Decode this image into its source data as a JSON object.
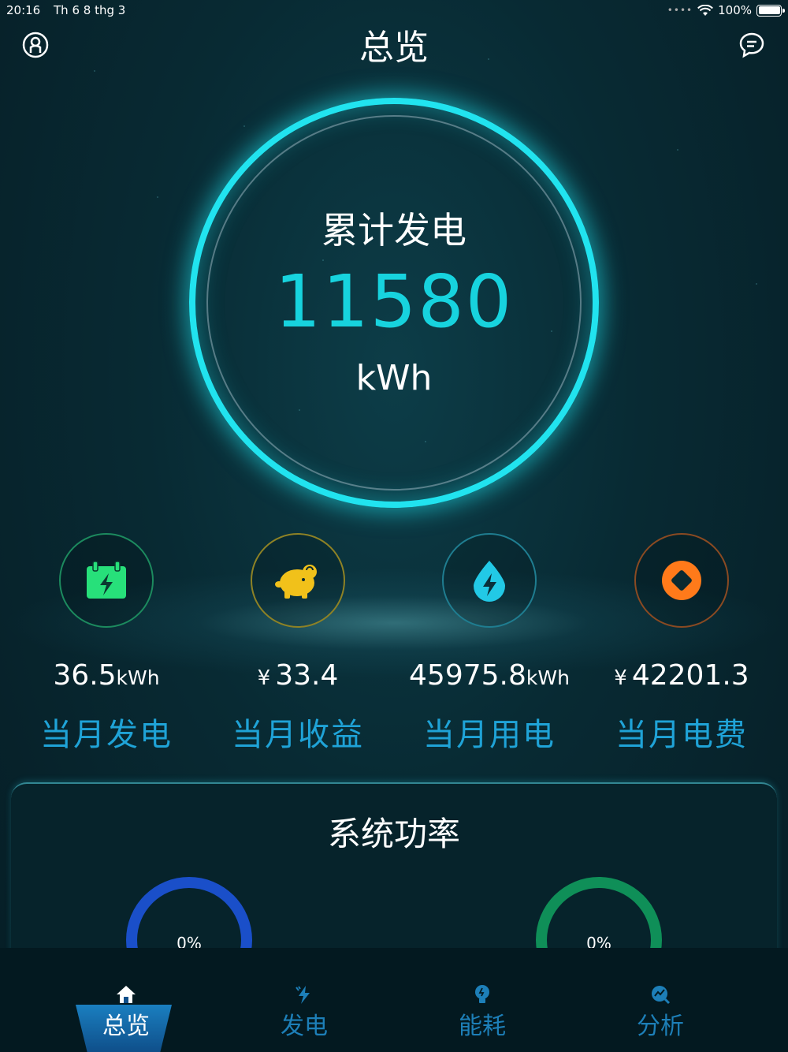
{
  "status_bar": {
    "time": "20:16",
    "date": "Th 6 8 thg 3",
    "battery": "100%"
  },
  "header": {
    "title": "总览",
    "left_icon": "user-icon",
    "right_icon": "message-icon"
  },
  "summary": {
    "label": "累计发电",
    "value": "11580",
    "unit": "kWh"
  },
  "stats": [
    {
      "icon": "calendar-bolt-icon",
      "value": "36.5",
      "unit": "kWh",
      "currency": "",
      "label": "当月发电",
      "color": "#27e07a"
    },
    {
      "icon": "piggy-bank-icon",
      "value": "33.4",
      "unit": "",
      "currency": "¥",
      "label": "当月收益",
      "color": "#f1c11a"
    },
    {
      "icon": "water-bolt-icon",
      "value": "45975.8",
      "unit": "kWh",
      "currency": "",
      "label": "当月用电",
      "color": "#22c9e6"
    },
    {
      "icon": "coin-icon",
      "value": "42201.3",
      "unit": "",
      "currency": "¥",
      "label": "当月电费",
      "color": "#ff7a1a"
    }
  ],
  "panel": {
    "title": "系统功率",
    "gauges": [
      {
        "text": "0%",
        "value": 0,
        "color": "#1a4fc9"
      },
      {
        "text": "0%",
        "value": 0,
        "color": "#0f8f58"
      }
    ]
  },
  "tabbar": {
    "tabs": [
      {
        "label": "总览",
        "icon": "home-icon",
        "active": true
      },
      {
        "label": "发电",
        "icon": "bolt-icon",
        "active": false
      },
      {
        "label": "能耗",
        "icon": "bulb-icon",
        "active": false
      },
      {
        "label": "分析",
        "icon": "analysis-icon",
        "active": false
      }
    ]
  },
  "colors": {
    "accent": "#17d3de",
    "label_blue": "#1fa3d7",
    "tab_inactive": "#1d7fb8"
  }
}
